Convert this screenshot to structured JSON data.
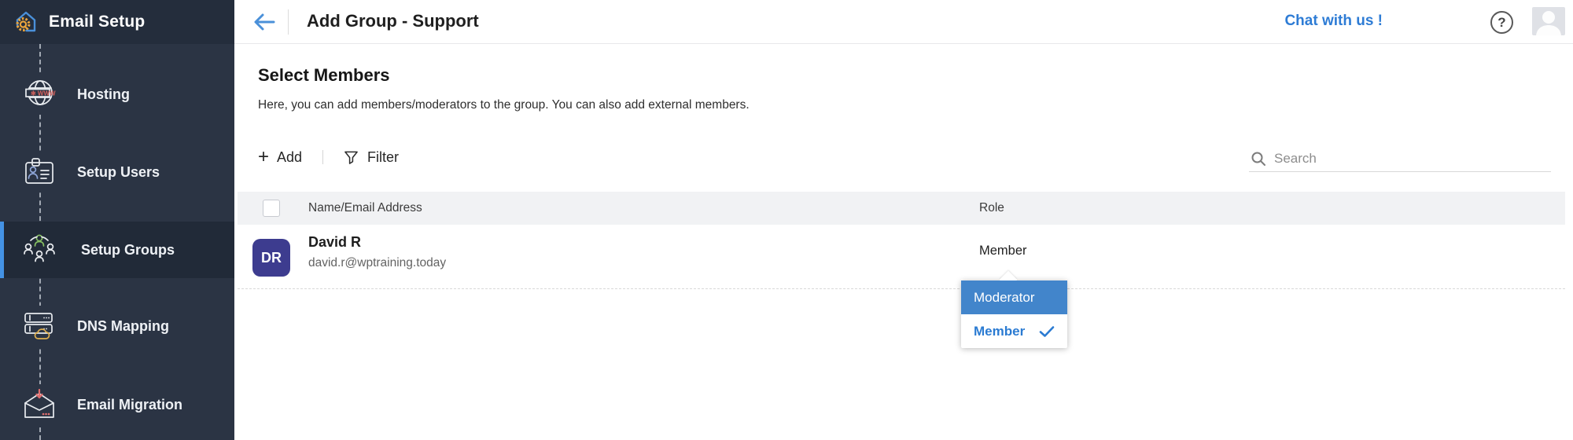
{
  "sidebar": {
    "title": "Email Setup",
    "items": [
      {
        "label": "Hosting",
        "icon": "globe-www-icon",
        "selected": false
      },
      {
        "label": "Setup Users",
        "icon": "id-card-icon",
        "selected": false
      },
      {
        "label": "Setup Groups",
        "icon": "people-group-icon",
        "selected": true
      },
      {
        "label": "DNS Mapping",
        "icon": "server-cloud-icon",
        "selected": false
      },
      {
        "label": "Email Migration",
        "icon": "mail-import-icon",
        "selected": false
      }
    ]
  },
  "topbar": {
    "title": "Add Group - Support",
    "chat_label": "Chat with us !",
    "help_label": "?"
  },
  "content": {
    "heading": "Select Members",
    "description": "Here, you can add members/moderators to the group. You can also add external members.",
    "toolbar": {
      "add_label": "Add",
      "plus_glyph": "+",
      "filter_label": "Filter",
      "search_placeholder": "Search"
    },
    "table": {
      "columns": [
        "Name/Email Address",
        "Role"
      ],
      "rows": [
        {
          "initials": "DR",
          "name": "David R",
          "email": "david.r@wptraining.today",
          "role": "Member",
          "avatar_color": "#3d3c8f"
        }
      ]
    },
    "role_dropdown": {
      "options": [
        {
          "label": "Moderator",
          "highlighted": true,
          "selected": false
        },
        {
          "label": "Member",
          "highlighted": false,
          "selected": true
        }
      ]
    }
  },
  "colors": {
    "sidebar_bg": "#2b3444",
    "sidebar_header_bg": "#242d3c",
    "sidebar_selected_bg": "#212a38",
    "accent_blue": "#4492e4",
    "link_blue": "#2e7cd5",
    "dropdown_highlight": "#4285cb",
    "dropdown_option_text": "#2b7bd2",
    "avatar_indigo": "#3d3c8f",
    "table_header_bg": "#f1f2f4"
  }
}
